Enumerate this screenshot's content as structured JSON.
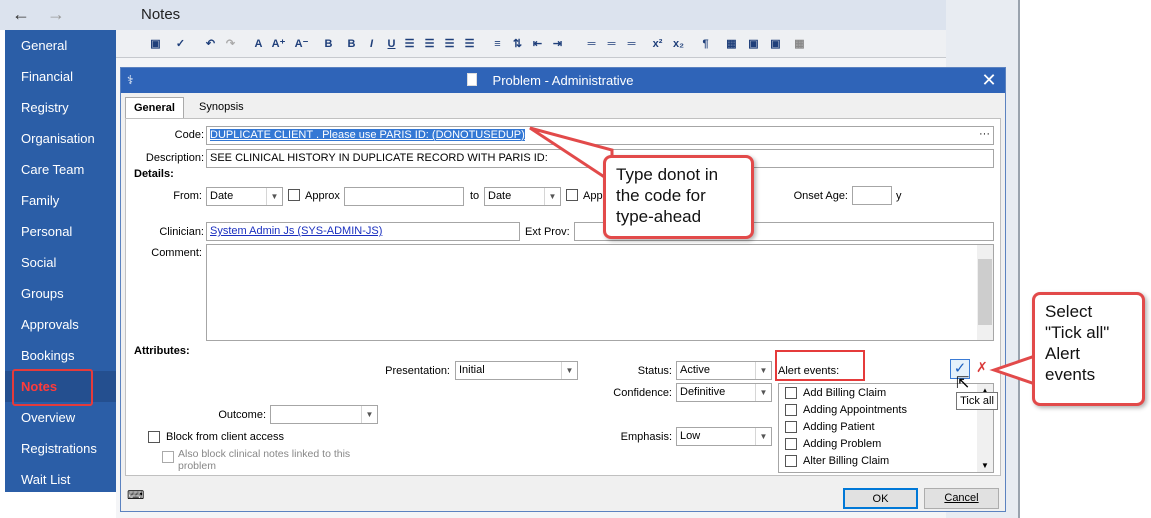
{
  "background": {
    "back_arrow": "←",
    "forward_arrow": "→",
    "title": "Notes",
    "toolbar_buttons": [
      "A",
      "A⁺",
      "A⁻",
      "B",
      "B",
      "I",
      "U",
      "¶",
      "x²",
      "x₂"
    ]
  },
  "sidebar": {
    "items": [
      {
        "label": "General"
      },
      {
        "label": "Financial"
      },
      {
        "label": "Registry"
      },
      {
        "label": "Organisation"
      },
      {
        "label": "Care Team"
      },
      {
        "label": "Family"
      },
      {
        "label": "Personal"
      },
      {
        "label": "Social"
      },
      {
        "label": "Groups"
      },
      {
        "label": "Approvals"
      },
      {
        "label": "Bookings"
      },
      {
        "label": "Notes"
      },
      {
        "label": "Overview"
      },
      {
        "label": "Registrations"
      },
      {
        "label": "Wait List"
      }
    ],
    "active": "Notes"
  },
  "dialog": {
    "title": "Problem - Administrative",
    "close": "✕",
    "tabs": {
      "general": "General",
      "synopsis": "Synopsis"
    },
    "code": {
      "label": "Code:",
      "value": "DUPLICATE CLIENT .  Please use PARIS ID: (DONOTUSEDUP)",
      "more": "···"
    },
    "description": {
      "label": "Description:",
      "value": "SEE CLINICAL HISTORY IN DUPLICATE RECORD WITH PARIS ID:"
    },
    "details_label": "Details:",
    "from": {
      "label": "From:",
      "value": "Date",
      "approx": "Approx"
    },
    "to": {
      "label": "to",
      "value": "Date",
      "approx": "Appro"
    },
    "onset_age": {
      "label": "Onset Age:",
      "unit": "y",
      "value": ""
    },
    "clinician": {
      "label": "Clinician:",
      "value": "System Admin Js (SYS-ADMIN-JS)"
    },
    "ext_prov": {
      "label": "Ext Prov:",
      "value": ""
    },
    "comment": {
      "label": "Comment:",
      "value": ""
    },
    "attributes_label": "Attributes:",
    "presentation": {
      "label": "Presentation:",
      "value": "Initial"
    },
    "status": {
      "label": "Status:",
      "value": "Active"
    },
    "confidence": {
      "label": "Confidence:",
      "value": "Definitive"
    },
    "emphasis": {
      "label": "Emphasis:",
      "value": "Low"
    },
    "outcome": {
      "label": "Outcome:",
      "value": ""
    },
    "alert_events": {
      "label": "Alert events:",
      "items": [
        "Add Billing Claim",
        "Adding Appointments",
        "Adding Patient",
        "Adding Problem",
        "Alter Billing Claim"
      ],
      "tooltip": "Tick all"
    },
    "block_access": {
      "label": "Block from client access"
    },
    "block_notes": {
      "label": "Also block clinical notes linked to this problem"
    },
    "ok": "OK",
    "cancel": "Cancel"
  },
  "callouts": {
    "typeahead": "Type donot in the code for type-ahead",
    "tickall": "Select \"Tick all\" Alert events"
  },
  "colors": {
    "sidebar": "#2b5ea7",
    "titlebar": "#2f64b8",
    "callout_border": "#e24a4a",
    "selection": "#3478d4"
  }
}
